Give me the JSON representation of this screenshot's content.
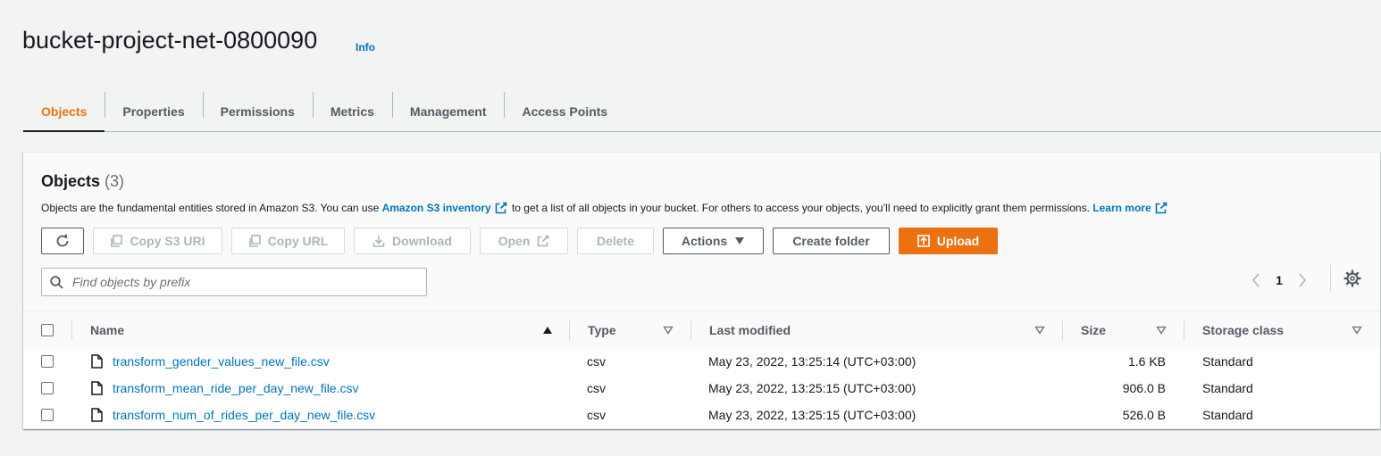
{
  "header": {
    "bucket_name": "bucket-project-net-0800090",
    "info_label": "Info"
  },
  "tabs": [
    {
      "label": "Objects",
      "active": true
    },
    {
      "label": "Properties",
      "active": false
    },
    {
      "label": "Permissions",
      "active": false
    },
    {
      "label": "Metrics",
      "active": false
    },
    {
      "label": "Management",
      "active": false
    },
    {
      "label": "Access Points",
      "active": false
    }
  ],
  "objects_panel": {
    "title": "Objects",
    "count": "(3)",
    "description_part1": "Objects are the fundamental entities stored in Amazon S3. You can use",
    "inventory_link": "Amazon S3 inventory",
    "description_part2": "to get a list of all objects in your bucket. For others to access your objects, you’ll need to explicitly grant them permissions.",
    "learn_more_link": "Learn more"
  },
  "toolbar": {
    "copy_s3_uri": "Copy S3 URI",
    "copy_url": "Copy URL",
    "download": "Download",
    "open": "Open",
    "delete": "Delete",
    "actions": "Actions",
    "create_folder": "Create folder",
    "upload": "Upload"
  },
  "search": {
    "placeholder": "Find objects by prefix",
    "value": ""
  },
  "pagination": {
    "current_page": "1"
  },
  "table": {
    "columns": {
      "name": "Name",
      "type": "Type",
      "last_modified": "Last modified",
      "size": "Size",
      "storage_class": "Storage class"
    },
    "rows": [
      {
        "name": "transform_gender_values_new_file.csv",
        "type": "csv",
        "last_modified": "May 23, 2022, 13:25:14 (UTC+03:00)",
        "size": "1.6 KB",
        "storage_class": "Standard"
      },
      {
        "name": "transform_mean_ride_per_day_new_file.csv",
        "type": "csv",
        "last_modified": "May 23, 2022, 13:25:15 (UTC+03:00)",
        "size": "906.0 B",
        "storage_class": "Standard"
      },
      {
        "name": "transform_num_of_rides_per_day_new_file.csv",
        "type": "csv",
        "last_modified": "May 23, 2022, 13:25:15 (UTC+03:00)",
        "size": "526.0 B",
        "storage_class": "Standard"
      }
    ]
  },
  "colors": {
    "accent_orange": "#ec7211",
    "link_blue": "#0073bb",
    "text_dark": "#16191f",
    "text_muted": "#545b64",
    "page_bg": "#f2f3f3"
  }
}
